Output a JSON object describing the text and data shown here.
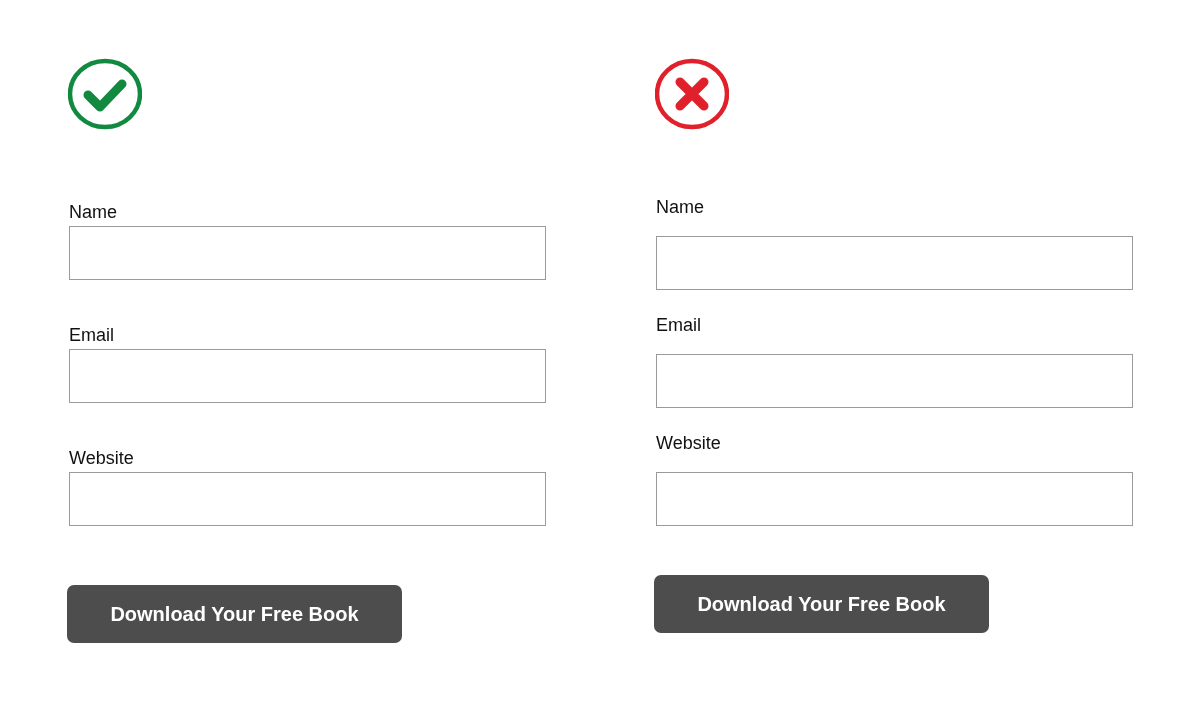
{
  "examples": [
    {
      "kind": "good",
      "fields": [
        {
          "label": "Name"
        },
        {
          "label": "Email"
        },
        {
          "label": "Website"
        }
      ],
      "button": "Download Your Free Book"
    },
    {
      "kind": "bad",
      "fields": [
        {
          "label": "Name"
        },
        {
          "label": "Email"
        },
        {
          "label": "Website"
        }
      ],
      "button": "Download Your Free Book"
    }
  ]
}
